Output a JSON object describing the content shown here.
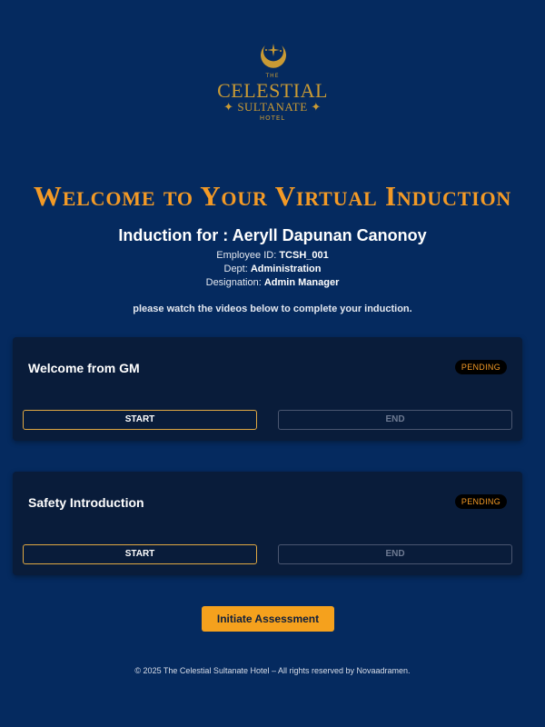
{
  "logo": {
    "the": "THE",
    "line1": "CELESTIAL",
    "line2": "✦ SULTANATE ✦",
    "line3": "HOTEL"
  },
  "header": {
    "welcome_title": "Welcome to Your Virtual Induction",
    "induction_for": "Induction for : Aeryll Dapunan Canonoy"
  },
  "employee": {
    "id_label": "Employee ID:",
    "id_value": "TCSH_001",
    "dept_label": "Dept:",
    "dept_value": "Administration",
    "designation_label": "Designation:",
    "designation_value": "Admin Manager"
  },
  "instruction": "please watch the videos below to complete your induction.",
  "videos": [
    {
      "title": "Welcome from GM",
      "status": "PENDING",
      "start_label": "START",
      "end_label": "END"
    },
    {
      "title": "Safety Introduction",
      "status": "PENDING",
      "start_label": "START",
      "end_label": "END"
    }
  ],
  "actions": {
    "assessment_label": "Initiate Assessment"
  },
  "footer": "© 2025 The Celestial Sultanate Hotel – All rights reserved by Novaadramen.",
  "colors": {
    "background": "#052a5f",
    "accent": "#f39a26",
    "gold": "#c99a34",
    "card": "#091c3a"
  }
}
